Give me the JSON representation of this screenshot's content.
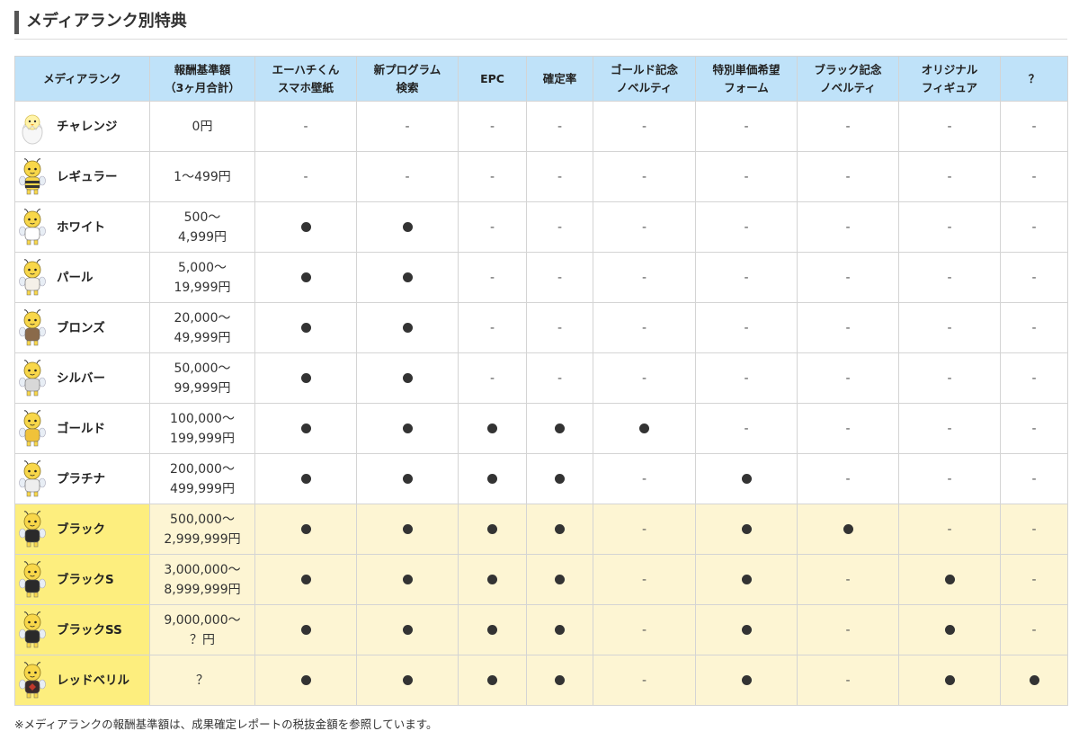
{
  "heading": {
    "title": "メディアランク別特典"
  },
  "table": {
    "headers": [
      [
        "メディアランク"
      ],
      [
        "報酬基準額",
        "（3ヶ月合計）"
      ],
      [
        "エーハチくん",
        "スマホ壁紙"
      ],
      [
        "新プログラム",
        "検索"
      ],
      [
        "EPC"
      ],
      [
        "確定率"
      ],
      [
        "ゴールド記念",
        "ノベルティ"
      ],
      [
        "特別単価希望",
        "フォーム"
      ],
      [
        "ブラック記念",
        "ノベルティ"
      ],
      [
        "オリジナル",
        "フィギュア"
      ],
      [
        "？"
      ]
    ],
    "rows": [
      {
        "rank": "チャレンジ",
        "icon": "egg-chick-icon",
        "amount": [
          "0円"
        ],
        "benefits": [
          "-",
          "-",
          "-",
          "-",
          "-",
          "-",
          "-",
          "-",
          "-"
        ]
      },
      {
        "rank": "レギュラー",
        "icon": "bee-regular-icon",
        "amount": [
          "1～499円"
        ],
        "benefits": [
          "-",
          "-",
          "-",
          "-",
          "-",
          "-",
          "-",
          "-",
          "-"
        ]
      },
      {
        "rank": "ホワイト",
        "icon": "bee-white-icon",
        "amount": [
          "500～",
          "4,999円"
        ],
        "benefits": [
          "●",
          "●",
          "-",
          "-",
          "-",
          "-",
          "-",
          "-",
          "-"
        ]
      },
      {
        "rank": "パール",
        "icon": "bee-pearl-icon",
        "amount": [
          "5,000～",
          "19,999円"
        ],
        "benefits": [
          "●",
          "●",
          "-",
          "-",
          "-",
          "-",
          "-",
          "-",
          "-"
        ]
      },
      {
        "rank": "ブロンズ",
        "icon": "bee-bronze-icon",
        "amount": [
          "20,000～",
          "49,999円"
        ],
        "benefits": [
          "●",
          "●",
          "-",
          "-",
          "-",
          "-",
          "-",
          "-",
          "-"
        ]
      },
      {
        "rank": "シルバー",
        "icon": "bee-silver-icon",
        "amount": [
          "50,000～",
          "99,999円"
        ],
        "benefits": [
          "●",
          "●",
          "-",
          "-",
          "-",
          "-",
          "-",
          "-",
          "-"
        ]
      },
      {
        "rank": "ゴールド",
        "icon": "bee-gold-icon",
        "amount": [
          "100,000～",
          "199,999円"
        ],
        "benefits": [
          "●",
          "●",
          "●",
          "●",
          "●",
          "-",
          "-",
          "-",
          "-"
        ]
      },
      {
        "rank": "プラチナ",
        "icon": "bee-platinum-icon",
        "amount": [
          "200,000～",
          "499,999円"
        ],
        "benefits": [
          "●",
          "●",
          "●",
          "●",
          "-",
          "●",
          "-",
          "-",
          "-"
        ]
      },
      {
        "rank": "ブラック",
        "icon": "bee-black-icon",
        "amount": [
          "500,000～",
          "2,999,999円"
        ],
        "benefits": [
          "●",
          "●",
          "●",
          "●",
          "-",
          "●",
          "●",
          "-",
          "-"
        ]
      },
      {
        "rank": "ブラックS",
        "icon": "bee-black-s-icon",
        "amount": [
          "3,000,000～",
          "8,999,999円"
        ],
        "benefits": [
          "●",
          "●",
          "●",
          "●",
          "-",
          "●",
          "-",
          "●",
          "-"
        ]
      },
      {
        "rank": "ブラックSS",
        "icon": "bee-black-ss-icon",
        "amount": [
          "9,000,000～",
          "？円"
        ],
        "benefits": [
          "●",
          "●",
          "●",
          "●",
          "-",
          "●",
          "-",
          "●",
          "-"
        ]
      },
      {
        "rank": "レッドベリル",
        "icon": "bee-red-beryl-icon",
        "amount": [
          "？"
        ],
        "benefits": [
          "●",
          "●",
          "●",
          "●",
          "-",
          "●",
          "-",
          "●",
          "●"
        ]
      }
    ]
  },
  "footnote": "※メディアランクの報酬基準額は、成果確定レポートの税抜金額を参照しています。",
  "colors": {
    "header_bg": "#bfe2f9",
    "black_tier_rank_bg": "#fdee7e",
    "black_tier_row_bg": "#fdf5d3",
    "heading_bar": "#555555"
  }
}
